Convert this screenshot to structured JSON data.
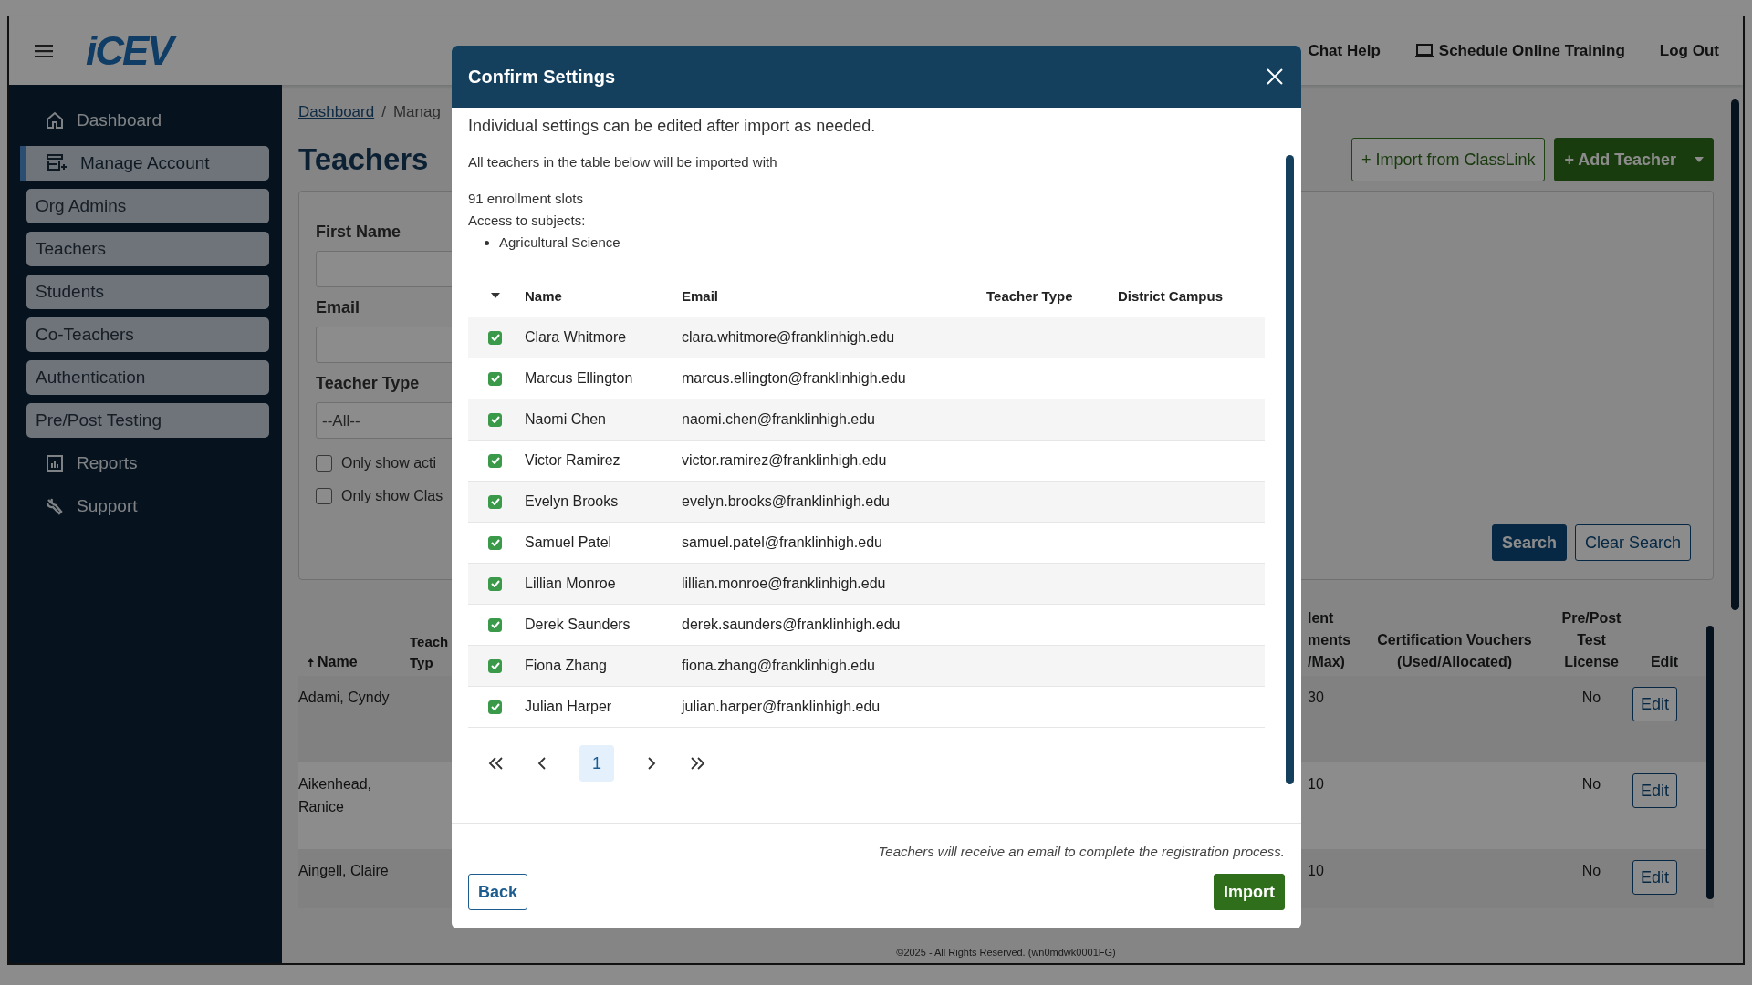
{
  "header": {
    "logo": "iCEV",
    "links": [
      {
        "label": "Chat Help",
        "kind": "text"
      },
      {
        "label": "Schedule Online Training",
        "kind": "monitor"
      },
      {
        "label": "Log Out",
        "kind": "text"
      }
    ]
  },
  "sidebar": {
    "items": [
      {
        "label": "Dashboard",
        "kind": "main",
        "selected": false
      },
      {
        "label": "Manage Account",
        "kind": "main",
        "selected": true
      },
      {
        "label": "Org Admins",
        "kind": "sub",
        "selected": false
      },
      {
        "label": "Teachers",
        "kind": "sub",
        "selected": false
      },
      {
        "label": "Students",
        "kind": "sub",
        "selected": false
      },
      {
        "label": "Co-Teachers",
        "kind": "sub",
        "selected": false
      },
      {
        "label": "Authentication",
        "kind": "sub",
        "selected": false
      },
      {
        "label": "Pre/Post Testing",
        "kind": "sub",
        "selected": false
      },
      {
        "label": "Reports",
        "kind": "main",
        "selected": false
      },
      {
        "label": "Support",
        "kind": "main",
        "selected": false
      }
    ]
  },
  "breadcrumb": [
    {
      "label": "Dashboard",
      "kind": "link"
    },
    {
      "label": "/",
      "kind": "separator"
    },
    {
      "label": "Manag",
      "kind": "current"
    }
  ],
  "page_title": "Teachers",
  "actions": [
    {
      "label": "+ Import from ClassLink",
      "kind": "outline"
    },
    {
      "label": "+ Add Teacher",
      "kind": "primary"
    }
  ],
  "filters": {
    "fields": [
      {
        "label": "First Name",
        "kind": "input"
      },
      {
        "label": "Email",
        "kind": "input"
      },
      {
        "label": "Teacher Type",
        "kind": "select",
        "value": "--All--"
      }
    ],
    "checkboxes": [
      {
        "label": "Only show acti",
        "checked": false
      },
      {
        "label": "Only show Clas",
        "checked": false
      }
    ],
    "buttons": [
      {
        "label": "Search",
        "kind": "primary"
      },
      {
        "label": "Clear Search",
        "kind": "outline"
      }
    ]
  },
  "teachers_table": {
    "columns": [
      {
        "label": "Name",
        "sorted": true
      },
      {
        "label": "Teach\nTyp",
        "sorted": false
      },
      {
        "label": "lent\nments\n/Max)",
        "sorted": false
      },
      {
        "label": "Certification Vouchers (Used/Allocated)",
        "sorted": false
      },
      {
        "label": "Pre/Post Test License",
        "sorted": false
      },
      {
        "label": "Edit",
        "sorted": false
      }
    ],
    "rows": [
      {
        "name": "Adami, Cyndy",
        "enrollments": "30",
        "license": "No",
        "edit": "Edit"
      },
      {
        "name": "Aikenhead, Ranice",
        "enrollments": "10",
        "license": "No",
        "edit": "Edit"
      },
      {
        "name": "Aingell, Claire",
        "enrollments": "10",
        "license": "No",
        "edit": "Edit"
      }
    ]
  },
  "footer": "©2025 - All Rights Reserved. (wn0mdwk0001FG)",
  "modal": {
    "title": "Confirm Settings",
    "intro": "Individual settings can be edited after import as needed.",
    "note": "All teachers in the table below will be imported with",
    "slots": "91 enrollment slots",
    "subjects_label": "Access to subjects:",
    "subjects": [
      "Agricultural Science"
    ],
    "columns": [
      "Name",
      "Email",
      "Teacher Type",
      "District Campus"
    ],
    "rows": [
      {
        "checked": true,
        "name": "Clara Whitmore",
        "email": "clara.whitmore@franklinhigh.edu"
      },
      {
        "checked": true,
        "name": "Marcus Ellington",
        "email": "marcus.ellington@franklinhigh.edu"
      },
      {
        "checked": true,
        "name": "Naomi Chen",
        "email": "naomi.chen@franklinhigh.edu"
      },
      {
        "checked": true,
        "name": "Victor Ramirez",
        "email": "victor.ramirez@franklinhigh.edu"
      },
      {
        "checked": true,
        "name": "Evelyn Brooks",
        "email": "evelyn.brooks@franklinhigh.edu"
      },
      {
        "checked": true,
        "name": "Samuel Patel",
        "email": "samuel.patel@franklinhigh.edu"
      },
      {
        "checked": true,
        "name": "Lillian Monroe",
        "email": "lillian.monroe@franklinhigh.edu"
      },
      {
        "checked": true,
        "name": "Derek Saunders",
        "email": "derek.saunders@franklinhigh.edu"
      },
      {
        "checked": true,
        "name": "Fiona Zhang",
        "email": "fiona.zhang@franklinhigh.edu"
      },
      {
        "checked": true,
        "name": "Julian Harper",
        "email": "julian.harper@franklinhigh.edu"
      }
    ],
    "pages": [
      {
        "label": "1",
        "selected": true
      }
    ],
    "footer_note": "Teachers will receive an email to complete the registration process.",
    "buttons": [
      {
        "label": "Back",
        "kind": "outline"
      },
      {
        "label": "Import",
        "kind": "primary"
      }
    ]
  }
}
